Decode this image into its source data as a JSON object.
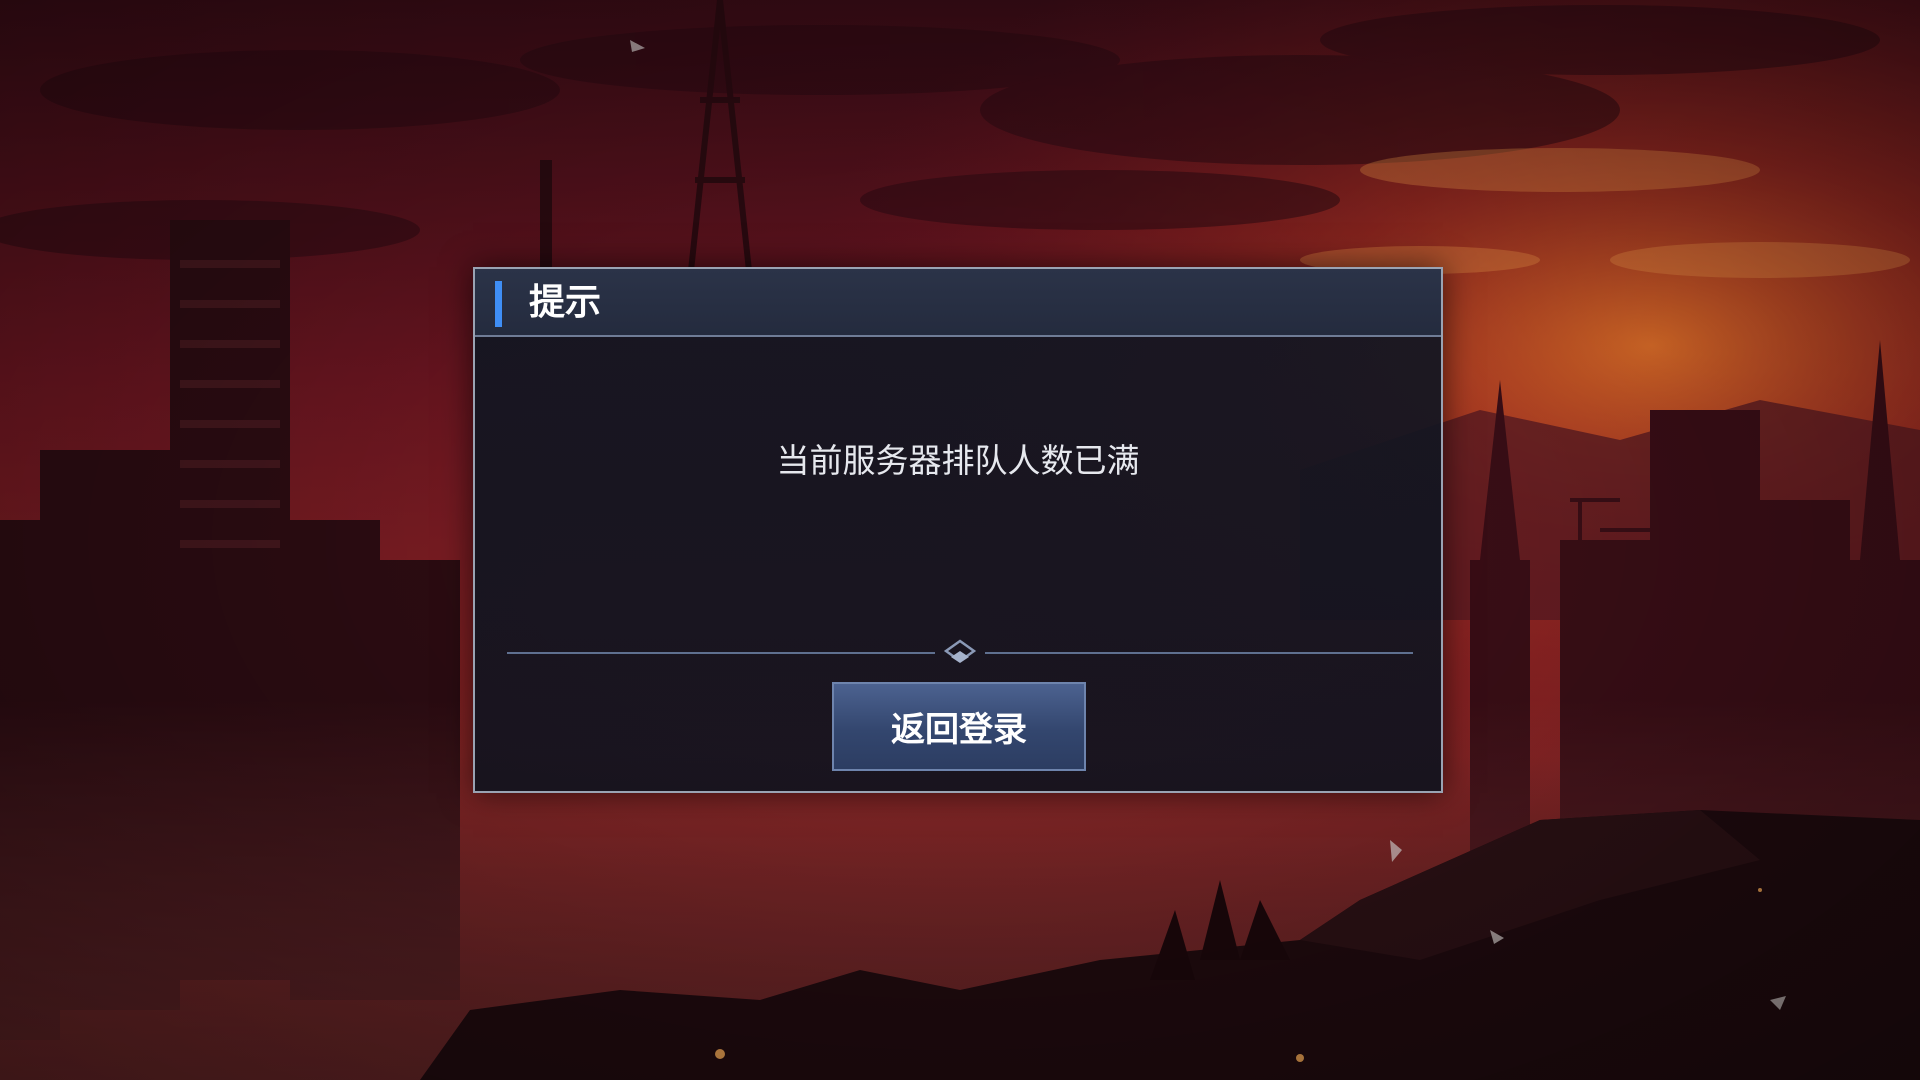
{
  "dialog": {
    "title": "提示",
    "message": "当前服务器排队人数已满",
    "button_label": "返回登录"
  },
  "colors": {
    "accent": "#3f8ef5",
    "sky_top": "#4a0f1a",
    "sky_glow": "#d0471f",
    "dialog_bg": "#141a28",
    "button_bg": "#3d5282"
  },
  "icons": {
    "divider": "diamond-chevron-icon"
  }
}
